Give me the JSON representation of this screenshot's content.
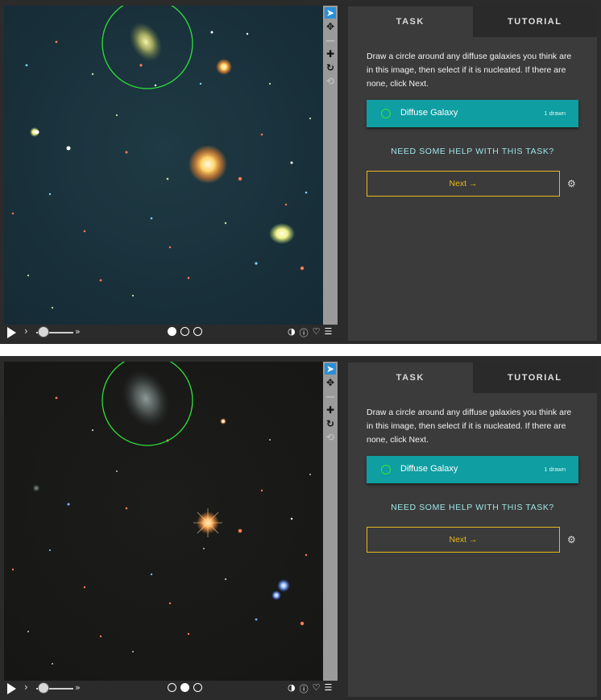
{
  "screenshots": [
    {
      "image": "galaxy-field-1",
      "toolbar": {
        "icons": [
          "cursor-arrow-icon",
          "move-icon",
          "zoom-out-icon",
          "zoom-in-icon",
          "rotate-icon",
          "reset-icon"
        ],
        "active_tool": "cursor-arrow-icon",
        "disabled_tools": [
          "zoom-out-icon",
          "reset-icon"
        ]
      },
      "playback": {
        "frames": 3,
        "current_frame": 1,
        "icons": [
          "play-icon",
          "step-arrow-icon",
          "fast-forward-icon",
          "invert-icon",
          "info-icon",
          "favorite-icon",
          "collections-icon"
        ]
      },
      "task": {
        "tabs": [
          "TASK",
          "TUTORIAL"
        ],
        "active_tab": "TASK",
        "instructions": "Draw a circle around any diffuse galaxies you think are in this image, then select if it is nucleated. If there are none, click Next.",
        "answer": {
          "label": "Diffuse Galaxy",
          "count": "1 drawn",
          "color": "#0f9ea2",
          "marker_color": "#39e239"
        },
        "help": "NEED SOME HELP WITH THIS TASK?",
        "next": "Next →",
        "settings_icon": "gear-icon"
      }
    },
    {
      "image": "galaxy-field-2",
      "toolbar": {
        "icons": [
          "cursor-arrow-icon",
          "move-icon",
          "zoom-out-icon",
          "zoom-in-icon",
          "rotate-icon",
          "reset-icon"
        ],
        "active_tool": "cursor-arrow-icon",
        "disabled_tools": [
          "zoom-out-icon",
          "reset-icon"
        ]
      },
      "playback": {
        "frames": 3,
        "current_frame": 2,
        "icons": [
          "play-icon",
          "step-arrow-icon",
          "fast-forward-icon",
          "invert-icon",
          "info-icon",
          "favorite-icon",
          "collections-icon"
        ]
      },
      "task": {
        "tabs": [
          "TASK",
          "TUTORIAL"
        ],
        "active_tab": "TASK",
        "instructions": "Draw a circle around any diffuse galaxies you think are in this image, then select if it is nucleated. If there are none, click Next.",
        "answer": {
          "label": "Diffuse Galaxy",
          "count": "1 drawn",
          "color": "#0f9ea2",
          "marker_color": "#39e239"
        },
        "help": "NEED SOME HELP WITH THIS TASK?",
        "next": "Next →",
        "settings_icon": "gear-icon"
      }
    }
  ]
}
